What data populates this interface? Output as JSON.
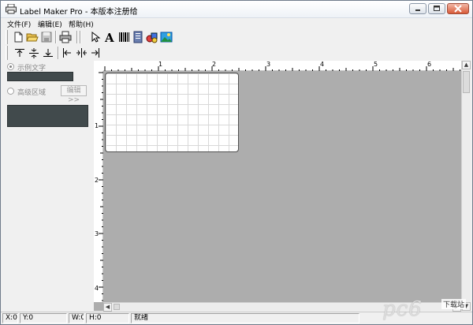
{
  "window": {
    "title": "Label Maker Pro - 本版本注册给",
    "buttons": [
      "minimize",
      "maximize",
      "close"
    ]
  },
  "menu": {
    "items": [
      "文件(F)",
      "编辑(E)",
      "帮助(H)"
    ]
  },
  "toolbar": {
    "row1_icons": [
      "new-document-icon",
      "open-folder-icon",
      "save-icon",
      "print-icon",
      "select-arrow-icon",
      "text-icon",
      "barcode-icon",
      "notepad-icon",
      "shapes-icon",
      "image-icon"
    ],
    "row2_icons": [
      "align-top-icon",
      "align-middle-icon",
      "align-bottom-icon",
      "align-left-icon",
      "align-center-icon",
      "align-right-icon"
    ]
  },
  "left_panel": {
    "option1_label": "示例文字",
    "option2_label": "高级区域",
    "edit_button_label": "编辑>>"
  },
  "ruler": {
    "top_labels": [
      "1",
      "2",
      "3",
      "4",
      "5",
      "6"
    ],
    "left_labels": [
      "1",
      "2",
      "3",
      "4"
    ]
  },
  "status": {
    "x": "X:0",
    "y": "Y:0",
    "w": "W:0",
    "h": "H:0",
    "state": "就绪"
  },
  "watermark": {
    "text": "pc6",
    "sub": "下载站"
  },
  "colors": {
    "canvas_bg": "#adadad",
    "panel_dark": "#414a4c",
    "close_button": "#d85a3a"
  }
}
